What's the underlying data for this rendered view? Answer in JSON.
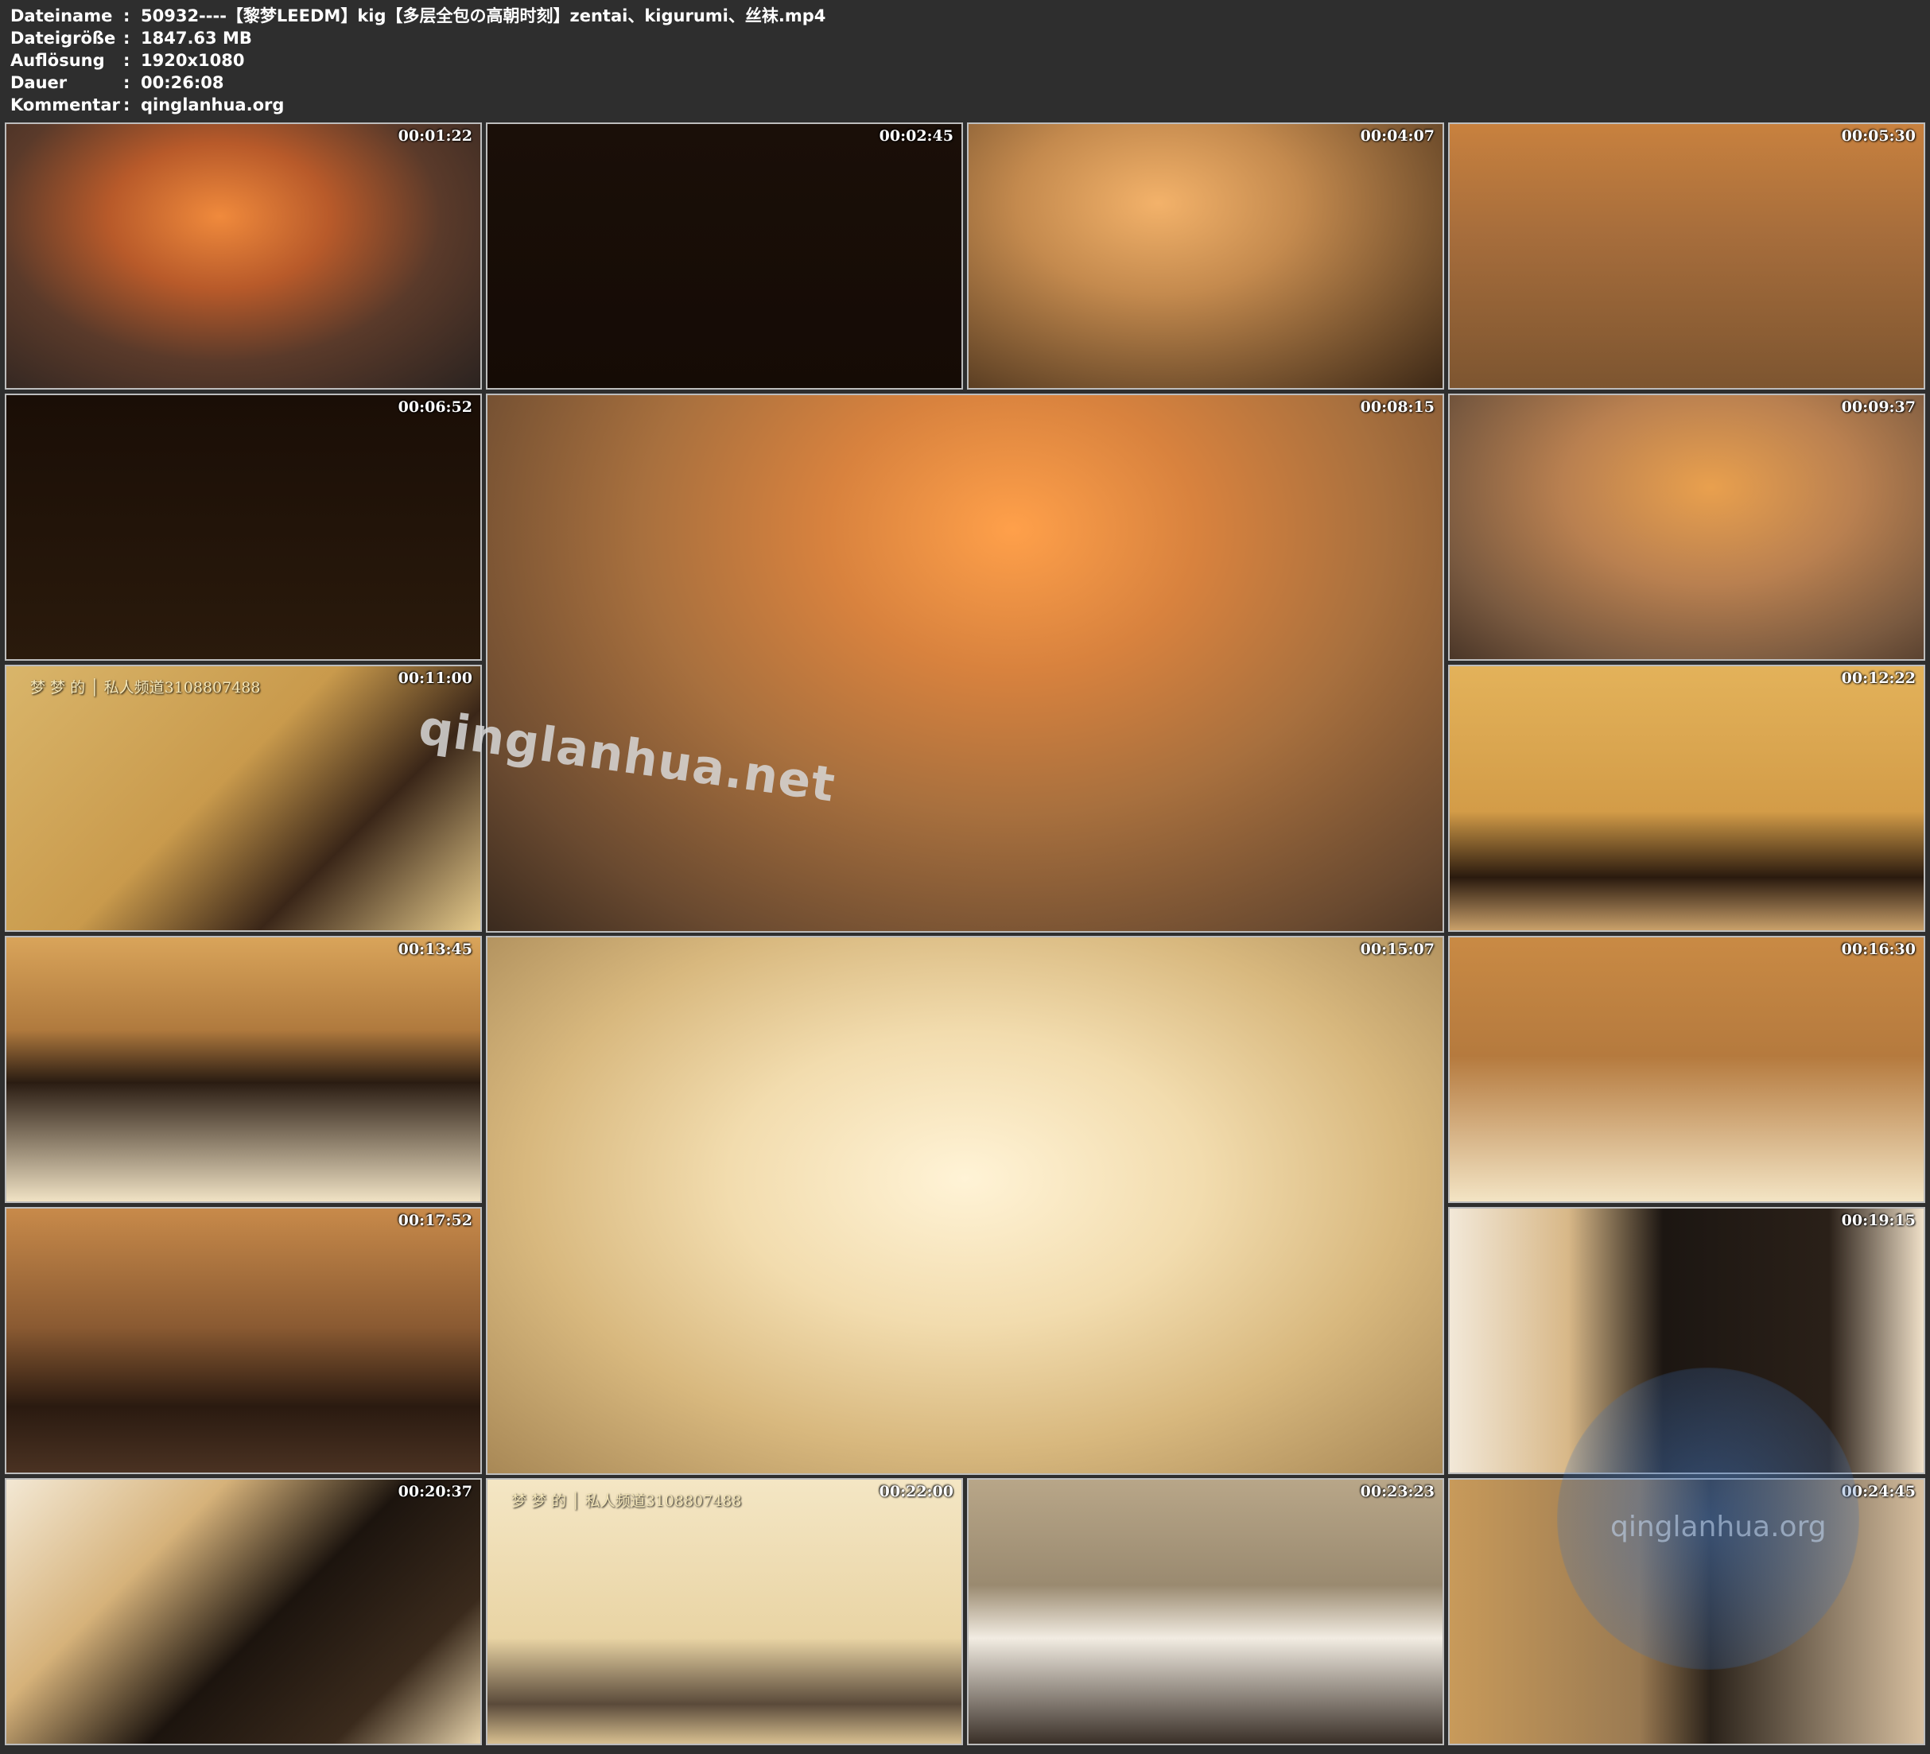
{
  "file_info": [
    {
      "label": "Dateiname",
      "value": "50932----【黎梦LEEDM】kig【多层全包の高朝时刻】zentai、kigurumi、丝袜.mp4"
    },
    {
      "label": "Dateigröße",
      "value": "1847.63 MB"
    },
    {
      "label": "Auflösung",
      "value": "1920x1080"
    },
    {
      "label": "Dauer",
      "value": "00:26:08"
    },
    {
      "label": "Kommentar",
      "value": "qinglanhua.org"
    }
  ],
  "separator": ":",
  "thumbnails": [
    {
      "timestamp": "00:01:22"
    },
    {
      "timestamp": "00:02:45"
    },
    {
      "timestamp": "00:04:07"
    },
    {
      "timestamp": "00:05:30"
    },
    {
      "timestamp": "00:06:52"
    },
    {
      "timestamp": "00:08:15"
    },
    {
      "timestamp": "00:09:37"
    },
    {
      "timestamp": "00:11:00",
      "overlay": "梦 梦 的 │ 私人频道3108807488"
    },
    {
      "timestamp": "00:12:22"
    },
    {
      "timestamp": "00:13:45"
    },
    {
      "timestamp": "00:15:07"
    },
    {
      "timestamp": "00:16:30"
    },
    {
      "timestamp": "00:17:52"
    },
    {
      "timestamp": "00:19:15"
    },
    {
      "timestamp": "00:20:37"
    },
    {
      "timestamp": "00:22:00",
      "overlay": "梦 梦 的 │ 私人频道3108807488"
    },
    {
      "timestamp": "00:23:23"
    },
    {
      "timestamp": "00:24:45"
    }
  ],
  "watermark": "qinglanhua.net",
  "corner_watermark": "qinglanhua.org"
}
